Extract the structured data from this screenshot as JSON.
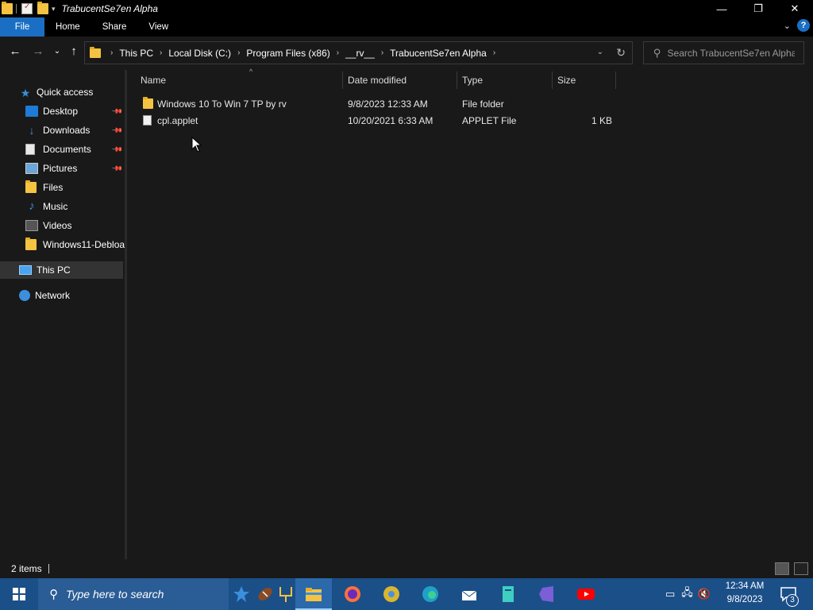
{
  "window": {
    "title": "TrabucentSe7en Alpha",
    "minimize_glyph": "—",
    "restore_glyph": "❐",
    "close_glyph": "✕"
  },
  "ribbon": {
    "tabs": [
      "File",
      "Home",
      "Share",
      "View"
    ],
    "help_glyph": "?"
  },
  "address": {
    "crumbs": [
      "This PC",
      "Local Disk (C:)",
      "Program Files (x86)",
      "__rv__",
      "TrabucentSe7en Alpha"
    ],
    "search_placeholder": "Search TrabucentSe7en Alpha"
  },
  "nav": {
    "items": [
      {
        "label": "Quick access",
        "icon": "star-icon",
        "pinned": false
      },
      {
        "label": "Desktop",
        "icon": "desktop-icon",
        "pinned": true
      },
      {
        "label": "Downloads",
        "icon": "download-icon",
        "pinned": true
      },
      {
        "label": "Documents",
        "icon": "documents-icon",
        "pinned": true
      },
      {
        "label": "Pictures",
        "icon": "pictures-icon",
        "pinned": true
      },
      {
        "label": "Files",
        "icon": "folder-icon",
        "pinned": false
      },
      {
        "label": "Music",
        "icon": "music-icon",
        "pinned": false
      },
      {
        "label": "Videos",
        "icon": "videos-icon",
        "pinned": false
      },
      {
        "label": "Windows11-Debloa",
        "icon": "folder-icon",
        "pinned": false
      },
      {
        "label": "This PC",
        "icon": "computer-icon",
        "pinned": false,
        "selected": true
      },
      {
        "label": "Network",
        "icon": "network-icon",
        "pinned": false
      }
    ]
  },
  "columns": [
    "Name",
    "Date modified",
    "Type",
    "Size"
  ],
  "files": [
    {
      "name": "Windows 10 To Win 7 TP by rv",
      "date": "9/8/2023 12:33 AM",
      "type": "File folder",
      "size": "",
      "icon": "folder-icon"
    },
    {
      "name": "cpl.applet",
      "date": "10/20/2021 6:33 AM",
      "type": "APPLET File",
      "size": "1 KB",
      "icon": "file-icon"
    }
  ],
  "status": {
    "item_count": "2 items"
  },
  "taskbar": {
    "search_placeholder": "Type here to search",
    "time": "12:34 AM",
    "date": "9/8/2023",
    "notification_count": "3"
  },
  "colors": {
    "accent": "#1a6fc4",
    "taskbar": "#1b4f88",
    "background": "#191919",
    "folder": "#f5c342"
  }
}
